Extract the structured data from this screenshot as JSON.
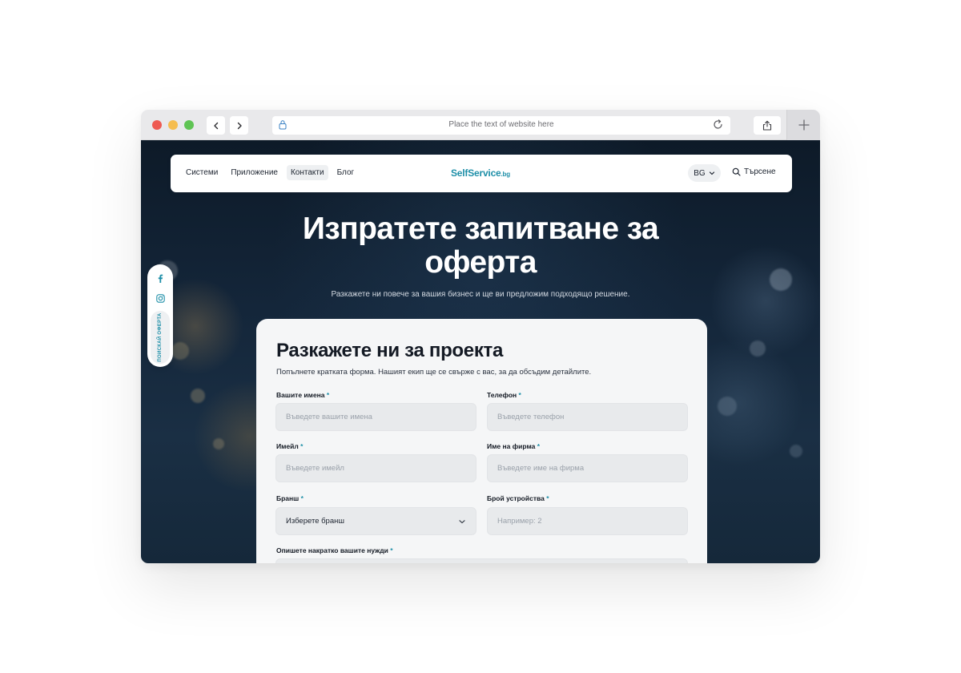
{
  "browser": {
    "url_placeholder": "Place the text of website here"
  },
  "header": {
    "menu": [
      "Системи",
      "Приложение",
      "Контакти",
      "Блог"
    ],
    "active_menu": "Контакти",
    "logo_main": "SelfService",
    "logo_tld": ".bg",
    "lang": "BG",
    "search_label": "Търсене"
  },
  "hero": {
    "title_line1": "Изпратете запитване за",
    "title_line2": "оферта",
    "subtitle": "Разкажете ни повече за вашия бизнес и ще ви предложим подходящо решение."
  },
  "side": {
    "cta": "ПОИСКАЙ ОФЕРТА",
    "icons": [
      "facebook-icon",
      "instagram-icon"
    ]
  },
  "form": {
    "title": "Разкажете ни за проекта",
    "subtitle": "Попълнете кратката форма. Нашият екип ще се свърже с вас, за да обсъдим детайлите.",
    "required_mark": "*",
    "fields": {
      "name": {
        "label": "Вашите имена",
        "placeholder": "Въведете вашите имена"
      },
      "phone": {
        "label": "Телефон",
        "placeholder": "Въведете телефон"
      },
      "email": {
        "label": "Имейл",
        "placeholder": "Въведете имейл"
      },
      "company": {
        "label": "Име на фирма",
        "placeholder": "Въведете име на фирма"
      },
      "industry": {
        "label": "Бранш",
        "value": "Изберете бранш"
      },
      "devices": {
        "label": "Брой устройства",
        "placeholder": "Например: 2"
      },
      "needs": {
        "label": "Опишете накратко вашите нужди"
      }
    }
  },
  "colors": {
    "accent": "#1e8fa8",
    "card_bg": "#f5f6f7",
    "input_bg": "#e8eaec"
  }
}
